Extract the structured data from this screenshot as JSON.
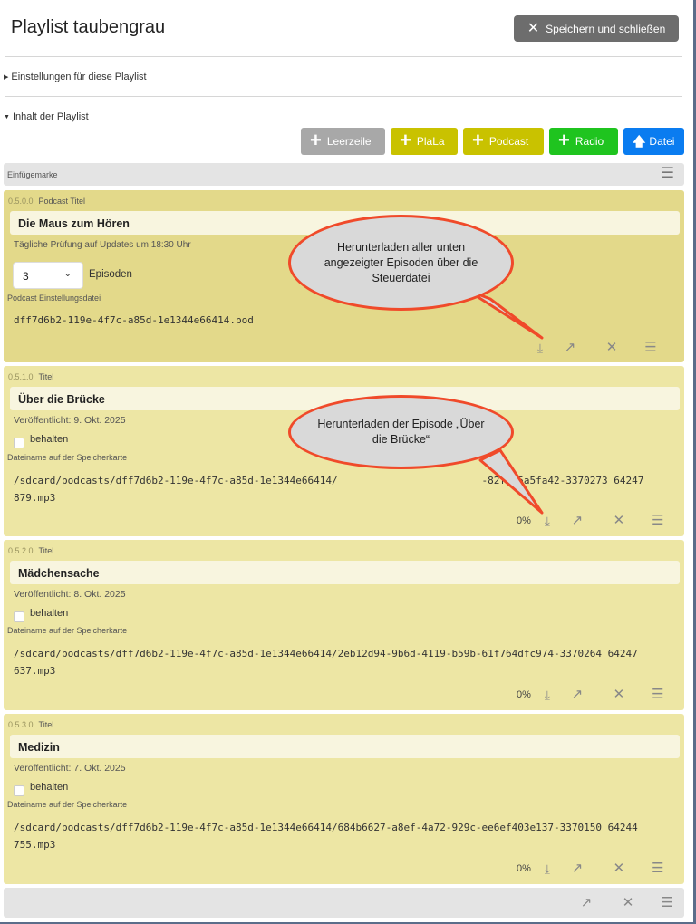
{
  "window": {
    "title": "Playlist taubengrau",
    "save_close_label": "Speichern und schließen"
  },
  "sections": {
    "settings_label": "Einstellungen für diese Playlist",
    "content_label": "Inhalt der Playlist"
  },
  "add_buttons": {
    "leerzeile": "Leerzeile",
    "plala": "PlaLa",
    "podcast": "Podcast",
    "radio": "Radio",
    "datei": "Datei",
    "colors": {
      "leerzeile": "#a8a8a8",
      "plala": "#c9c200",
      "podcast": "#c9c200",
      "radio": "#1fc41f",
      "datei": "#0a7cf0"
    }
  },
  "insert_marker": {
    "label": "Einfügemarke"
  },
  "podcast_card": {
    "index": "0.5.0.0",
    "type": "Podcast Titel",
    "title": "Die Maus zum Hören",
    "update_info": "Tägliche Prüfung auf Updates um 18:30 Uhr",
    "episodes_count": "3",
    "episodes_label": "Episoden",
    "file_label": "Podcast Einstellungsdatei",
    "file": "dff7d6b2-119e-4f7c-a85d-1e1344e66414.pod"
  },
  "episodes": [
    {
      "index": "0.5.1.0",
      "type": "Titel",
      "title": "Über die Brücke",
      "published": "Veröffentlicht: 9. Okt. 2025",
      "keep_label": "behalten",
      "file_label": "Dateiname auf der Speicherkarte",
      "file_line1": "/sdcard/podcasts/dff7d6b2-119e-4f7c-a85d-1e1344e66414/                        -82fb95a5fa42-3370273_64247",
      "file_line2": "879.mp3",
      "progress": "0%"
    },
    {
      "index": "0.5.2.0",
      "type": "Titel",
      "title": "Mädchensache",
      "published": "Veröffentlicht: 8. Okt. 2025",
      "keep_label": "behalten",
      "file_label": "Dateiname auf der Speicherkarte",
      "file_line1": "/sdcard/podcasts/dff7d6b2-119e-4f7c-a85d-1e1344e66414/2eb12d94-9b6d-4119-b59b-61f764dfc974-3370264_64247",
      "file_line2": "637.mp3",
      "progress": "0%"
    },
    {
      "index": "0.5.3.0",
      "type": "Titel",
      "title": "Medizin",
      "published": "Veröffentlicht: 7. Okt. 2025",
      "keep_label": "behalten",
      "file_label": "Dateiname auf der Speicherkarte",
      "file_line1": "/sdcard/podcasts/dff7d6b2-119e-4f7c-a85d-1e1344e66414/684b6627-a8ef-4a72-929c-ee6ef403e137-3370150_64244",
      "file_line2": "755.mp3",
      "progress": "0%"
    }
  ],
  "callouts": {
    "first": "Herunterladen aller unten angezeigter Episoden über die Steuerdatei",
    "second": "Herunterladen der Episode „Über die Brücke“"
  },
  "icons": {
    "download": "download-icon",
    "move": "arrow-up-right-icon",
    "remove": "close-icon",
    "menu": "menu-icon"
  }
}
